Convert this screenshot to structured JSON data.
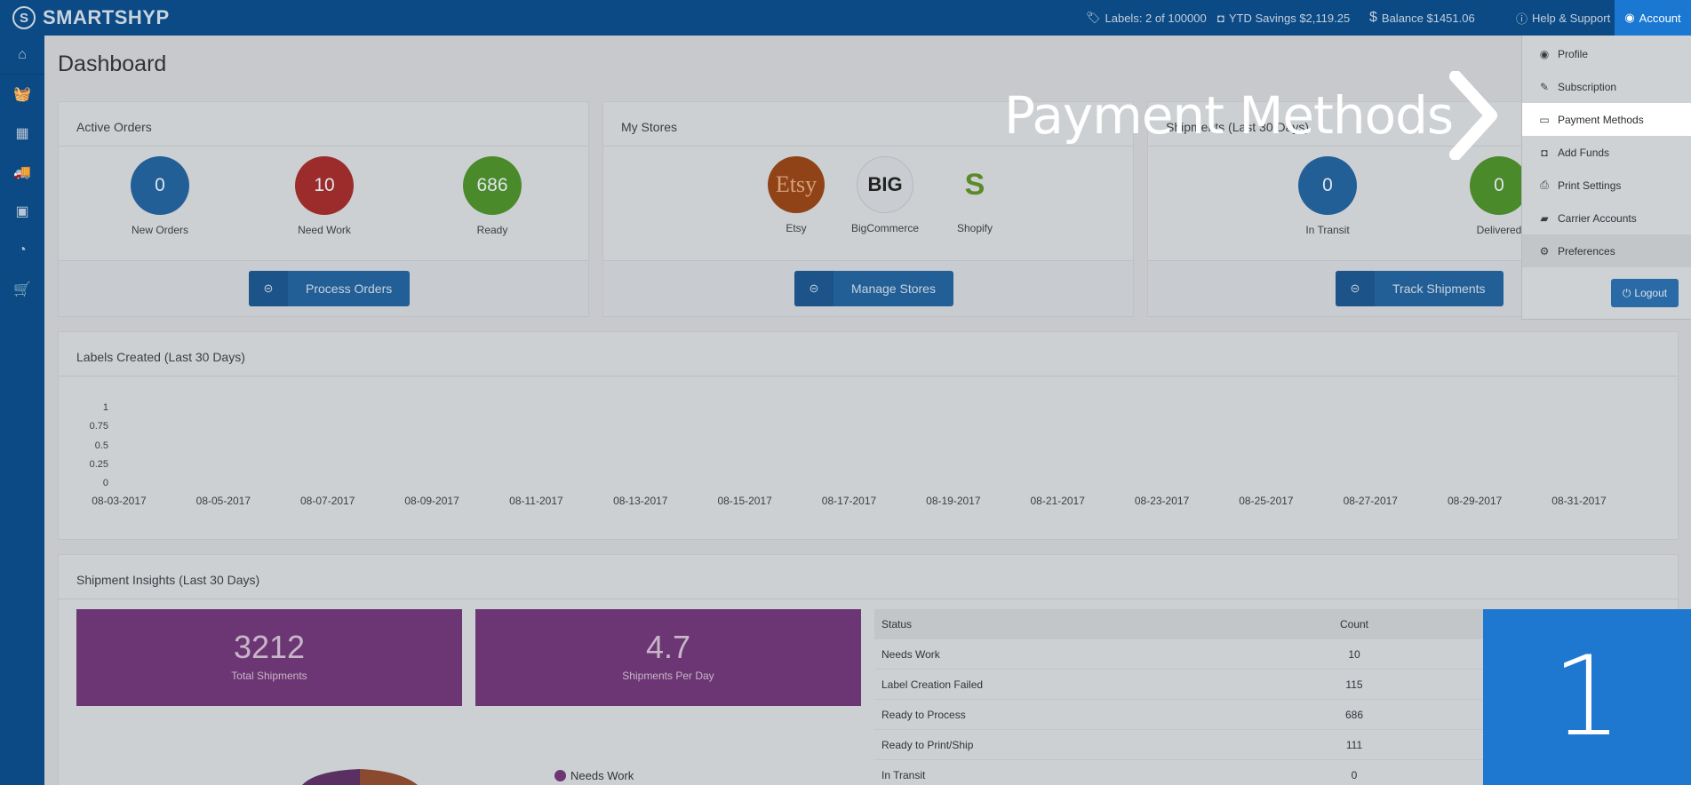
{
  "brand": {
    "logo": "S",
    "name": "SMARTSHYP"
  },
  "topnav": {
    "labels": "Labels: 2 of 100000",
    "ytd_savings": "YTD Savings $2,119.25",
    "balance": "Balance $1451.06",
    "help": "Help & Support",
    "account": "Account",
    "icons": {
      "labels": "tag-icon",
      "savings": "money-icon",
      "balance": "dollar-icon",
      "help": "question-icon",
      "account": "user-circle-icon"
    }
  },
  "sidebar": {
    "items": [
      {
        "icon": "home-icon",
        "glyph": "⌂"
      },
      {
        "icon": "basket-icon",
        "glyph": "🧺"
      },
      {
        "icon": "calendar-icon",
        "glyph": "▦"
      },
      {
        "icon": "truck-icon",
        "glyph": "🚚"
      },
      {
        "icon": "address-book-icon",
        "glyph": "▣"
      },
      {
        "icon": "pie-chart-icon",
        "glyph": "◔"
      },
      {
        "icon": "cart-icon",
        "glyph": "🛒"
      }
    ]
  },
  "page": {
    "title": "Dashboard"
  },
  "active_orders": {
    "title": "Active Orders",
    "stats": [
      {
        "value": "0",
        "label": "New Orders"
      },
      {
        "value": "10",
        "label": "Need Work"
      },
      {
        "value": "686",
        "label": "Ready"
      }
    ],
    "button": "Process Orders"
  },
  "my_stores": {
    "title": "My Stores",
    "stores": [
      {
        "logo": "Etsy",
        "label": "Etsy"
      },
      {
        "logo": "BIG",
        "label": "BigCommerce"
      },
      {
        "logo": "S",
        "label": "Shopify"
      }
    ],
    "button": "Manage Stores"
  },
  "shipments": {
    "title": "Shipments (Last 30 Days)",
    "stats": [
      {
        "value": "0",
        "label": "In Transit"
      },
      {
        "value": "0",
        "label": "Delivered"
      }
    ],
    "button": "Track Shipments"
  },
  "labels_chart": {
    "title": "Labels Created (Last 30 Days)"
  },
  "chart_data": {
    "type": "line",
    "title": "Labels Created (Last 30 Days)",
    "xlabel": "",
    "ylabel": "",
    "yticks": [
      "1",
      "0.75",
      "0.5",
      "0.25",
      "0"
    ],
    "ylim": [
      0,
      1
    ],
    "x": [
      "08-03-2017",
      "08-05-2017",
      "08-07-2017",
      "08-09-2017",
      "08-11-2017",
      "08-13-2017",
      "08-15-2017",
      "08-17-2017",
      "08-19-2017",
      "08-21-2017",
      "08-23-2017",
      "08-25-2017",
      "08-27-2017",
      "08-29-2017",
      "08-31-2017"
    ],
    "series": [],
    "grid": false
  },
  "insights": {
    "title": "Shipment Insights (Last 30 Days)",
    "boxes": [
      {
        "value": "3212",
        "label": "Total Shipments"
      },
      {
        "value": "4.7",
        "label": "Shipments Per Day"
      }
    ],
    "legend_first": "Needs Work",
    "table": {
      "headers": [
        "Status",
        "Count"
      ],
      "rows": [
        [
          "Needs Work",
          "10"
        ],
        [
          "Label Creation Failed",
          "115"
        ],
        [
          "Ready to Process",
          "686"
        ],
        [
          "Ready to Print/Ship",
          "111"
        ],
        [
          "In Transit",
          "0"
        ]
      ]
    }
  },
  "account_menu": {
    "items": [
      {
        "label": "Profile",
        "icon": "user-circle-icon",
        "glyph": "◉"
      },
      {
        "label": "Subscription",
        "icon": "ticket-icon",
        "glyph": "✎"
      },
      {
        "label": "Payment Methods",
        "icon": "credit-card-icon",
        "glyph": "▭"
      },
      {
        "label": "Add Funds",
        "icon": "money-icon",
        "glyph": "◘"
      },
      {
        "label": "Print Settings",
        "icon": "printer-icon",
        "glyph": "⎙"
      },
      {
        "label": "Carrier Accounts",
        "icon": "truck-icon",
        "glyph": "▰"
      },
      {
        "label": "Preferences",
        "icon": "gears-icon",
        "glyph": "⚙"
      }
    ],
    "logout": "Logout"
  },
  "tutorial": {
    "callout": "Payment Methods",
    "step": "1"
  },
  "colors": {
    "nav": "#0b4a85",
    "accent": "#1a78d2",
    "purple": "#6b3673",
    "step_box": "#1e78d0"
  }
}
